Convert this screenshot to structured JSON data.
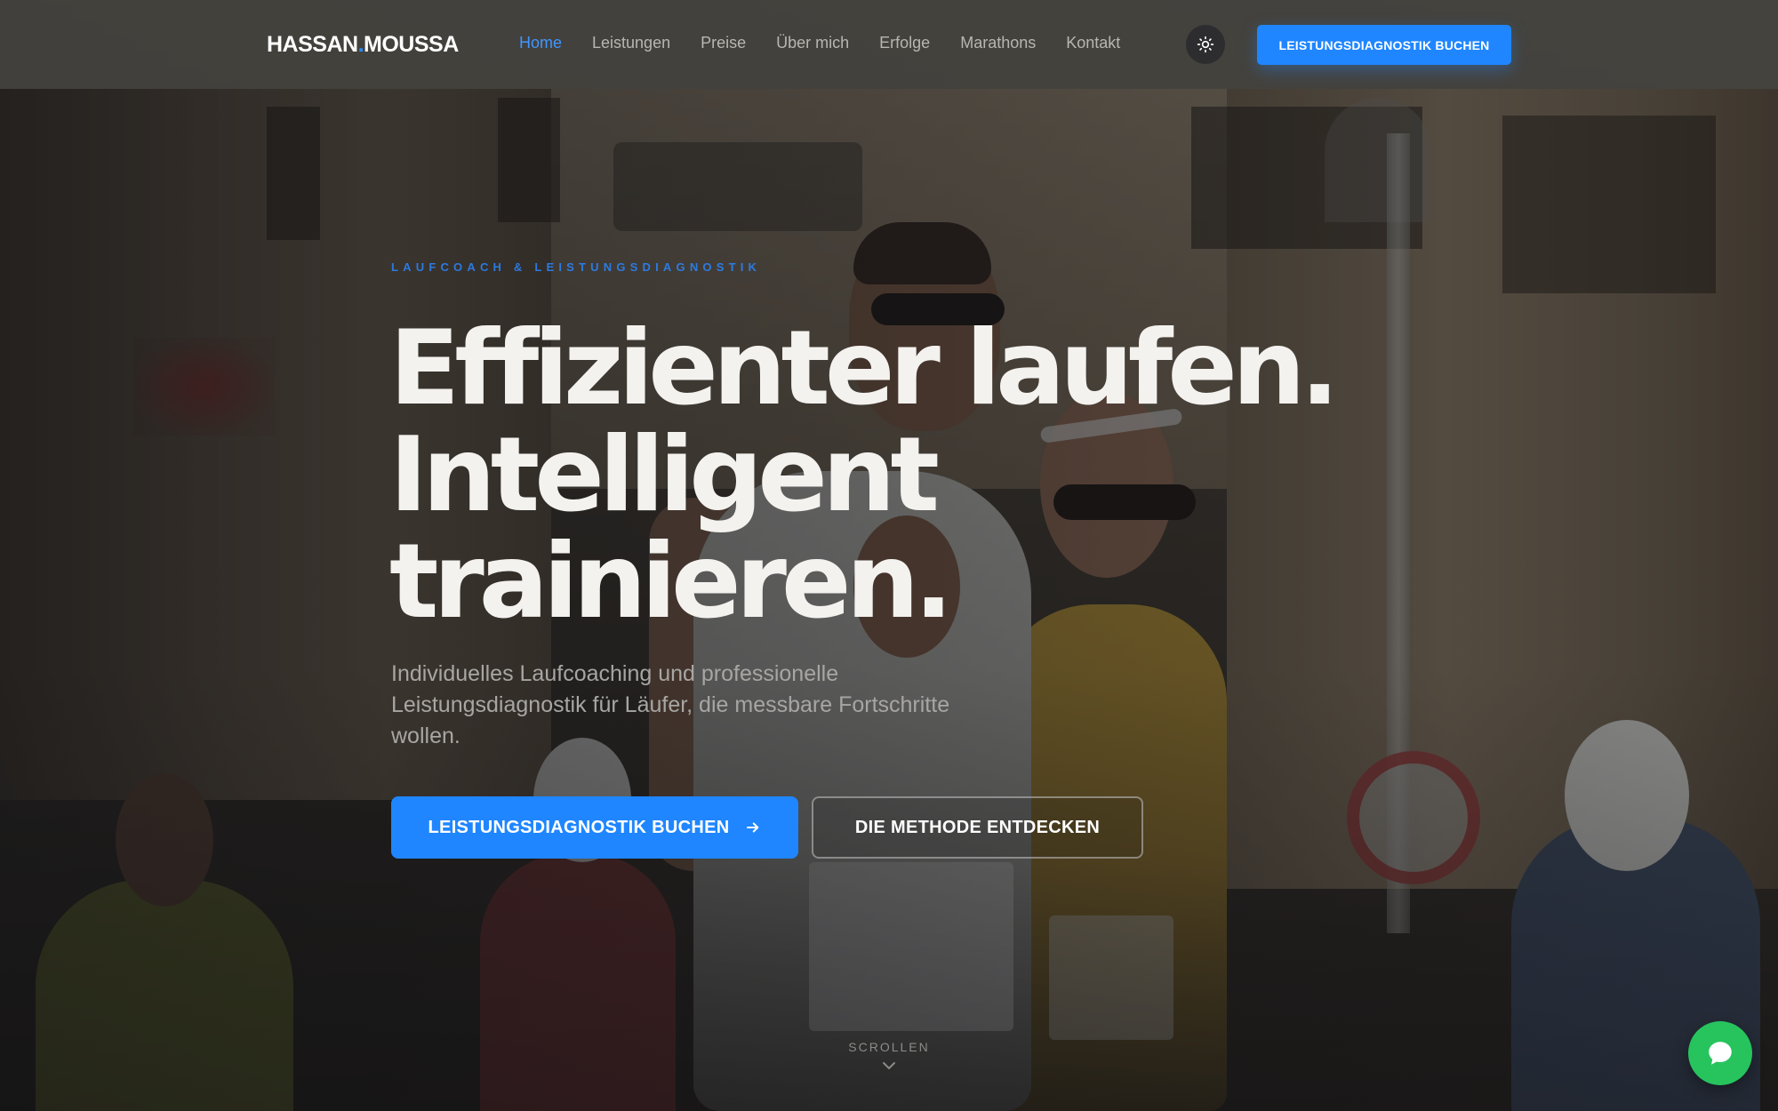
{
  "nav": {
    "logo_first": "HASSAN",
    "logo_dot": ".",
    "logo_last": "MOUSSA",
    "links": [
      "Home",
      "Leistungen",
      "Preise",
      "Über mich",
      "Erfolge",
      "Marathons",
      "Kontakt"
    ],
    "active_link": "Home",
    "cta_label": "LEISTUNGSDIAGNOSTIK BUCHEN"
  },
  "hero": {
    "eyebrow": "LAUFCOACH & LEISTUNGSDIAGNOSTIK",
    "headline_lines": [
      "Effizienter laufen.",
      "Intelligent",
      "trainieren."
    ],
    "subtitle": "Individuelles Laufcoaching und professionelle Leistungsdiagnostik für Läufer, die messbare Fortschritte wollen.",
    "primary_button": "LEISTUNGSDIAGNOSTIK BUCHEN",
    "secondary_button": "DIE METHODE ENTDECKEN",
    "scroll_label": "SCROLLEN"
  },
  "colors": {
    "accent": "#1f86ff",
    "active_nav": "#3f96ff",
    "chat": "#27c45e"
  },
  "icons": {
    "theme_toggle": "sun-icon",
    "primary_button": "arrow-right-icon",
    "scroll": "chevron-down-icon",
    "chat": "chat-bubble-icon"
  }
}
